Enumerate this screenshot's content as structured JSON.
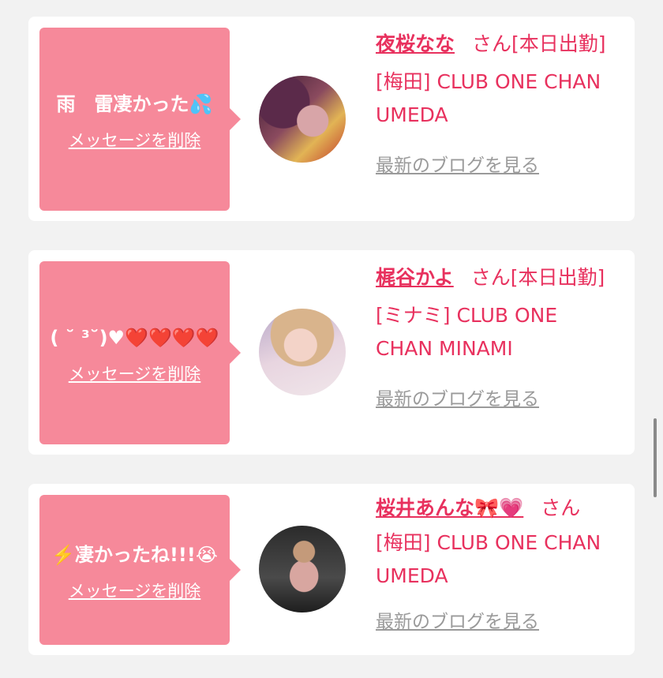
{
  "delete_label": "メッセージを削除",
  "blog_label": "最新のブログを見る",
  "san_label": "さん",
  "today_badge": "[本日出勤]",
  "colors": {
    "bubble": "#f6899a",
    "accent": "#e8315e",
    "muted_link": "#9a9a9a",
    "background": "#f2f2f2"
  },
  "messages": [
    {
      "text": "雨　雷凄かった💦",
      "name": "夜桜なな",
      "shop": "[梅田] CLUB ONE CHAN UMEDA"
    },
    {
      "text": "( ˘ ³˘)♥❤️❤️❤️❤️",
      "name": "梶谷かよ",
      "shop": "[ミナミ] CLUB ONE CHAN MINAMI"
    },
    {
      "text": "⚡️凄かったね!!!😭",
      "name": "桜井あんな🎀💗",
      "shop": "[梅田] CLUB ONE CHAN UMEDA"
    }
  ]
}
